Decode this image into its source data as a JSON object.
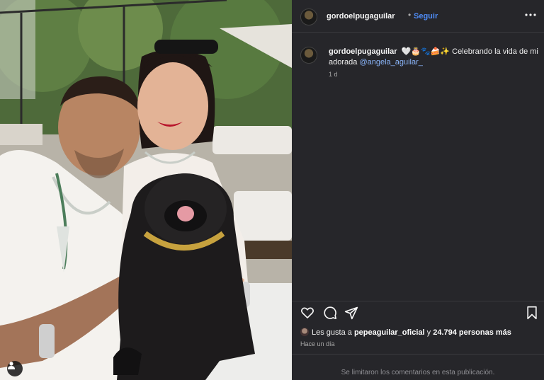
{
  "post": {
    "author": "gordoelpugaguilar",
    "separator": "•",
    "follow_label": "Seguir",
    "caption": {
      "username": "gordoelpugaguilar",
      "emojis": "🤍🎂🐾🍰✨",
      "text": "Celebrando la vida de mi adorada",
      "mention": "@angela_aguilar_",
      "age": "1 d"
    },
    "likes": {
      "prefix": "Les gusta a",
      "user": "pepeaguilar_oficial",
      "middle": "y",
      "count": "24.794 personas más"
    },
    "timestamp": "Hace un día",
    "comments_notice": "Se limitaron los comentarios en esta publicación."
  },
  "icons": {
    "more": "more-options-icon",
    "like": "heart-icon",
    "comment": "comment-icon",
    "share": "share-icon",
    "save": "bookmark-icon",
    "user_tags": "user-tag-icon"
  },
  "colors": {
    "panel": "#26262a",
    "link": "#4f8cf7",
    "mention": "#8ab4f8",
    "muted": "#a8a8a8"
  }
}
